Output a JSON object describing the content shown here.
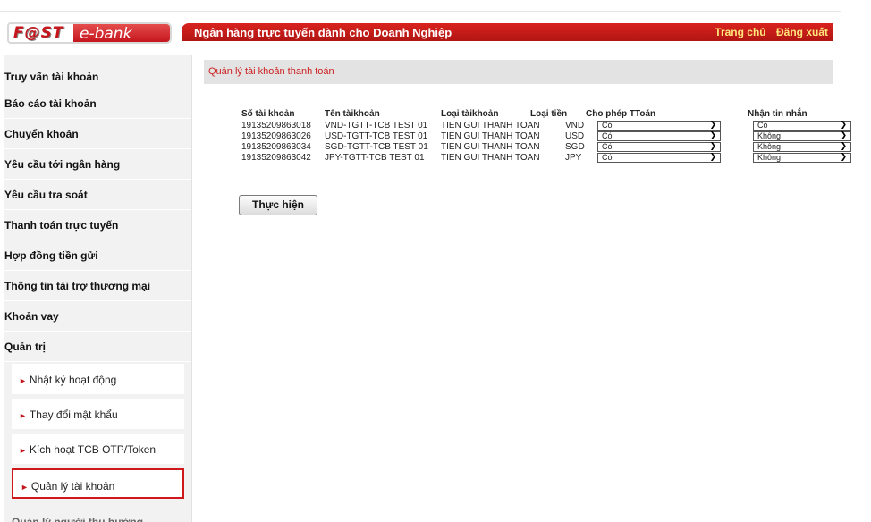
{
  "logo": {
    "part1": "F@ST",
    "part2": "e-bank"
  },
  "header": {
    "title": "Ngân hàng trực tuyến dành cho Doanh Nghiệp",
    "home_link": "Trang chủ",
    "logout_link": "Đăng xuất"
  },
  "sidebar": {
    "items": [
      {
        "label": "Truy vấn tài khoản"
      },
      {
        "label": "Báo cáo tài khoản"
      },
      {
        "label": "Chuyển khoản"
      },
      {
        "label": "Yêu cầu tới ngân hàng"
      },
      {
        "label": "Yêu cầu tra soát"
      },
      {
        "label": "Thanh toán trực tuyến"
      },
      {
        "label": "Hợp đồng tiền gửi"
      },
      {
        "label": "Thông tin tài trợ thương mại"
      },
      {
        "label": "Khoản vay"
      },
      {
        "label": "Quản trị"
      }
    ],
    "sub_items": [
      {
        "label": "Nhật ký hoạt động"
      },
      {
        "label": "Thay đổi mật khẩu"
      },
      {
        "label": "Kích hoạt TCB OTP/Token"
      },
      {
        "label": "Quản lý tài khoản"
      }
    ],
    "partial_item": "Quản lý người thụ hưởng"
  },
  "content": {
    "title": "Quản lý tài khoản thanh toán",
    "columns": {
      "account_no": "Số tài khoản",
      "account_name": "Tên tàikhoản",
      "account_type": "Loại tàikhoản",
      "currency": "Loại tiền",
      "allow_payment": "Cho phép TToán",
      "sms": "Nhận tin nhắn"
    },
    "rows": [
      {
        "account_no": "19135209863018",
        "account_name": "VND-TGTT-TCB TEST 01",
        "account_type": "TIEN GUI THANH TOAN",
        "currency": "VND",
        "allow_payment": "Có",
        "sms": "Có"
      },
      {
        "account_no": "19135209863026",
        "account_name": "USD-TGTT-TCB TEST 01",
        "account_type": "TIEN GUI THANH TOAN",
        "currency": "USD",
        "allow_payment": "Có",
        "sms": "Không"
      },
      {
        "account_no": "19135209863034",
        "account_name": "SGD-TGTT-TCB TEST 01",
        "account_type": "TIEN GUI THANH TOAN",
        "currency": "SGD",
        "allow_payment": "Có",
        "sms": "Không"
      },
      {
        "account_no": "19135209863042",
        "account_name": "JPY-TGTT-TCB TEST 01",
        "account_type": "TIEN GUI THANH TOAN",
        "currency": "JPY",
        "allow_payment": "Có",
        "sms": "Không"
      }
    ],
    "submit_label": "Thực hiện"
  }
}
